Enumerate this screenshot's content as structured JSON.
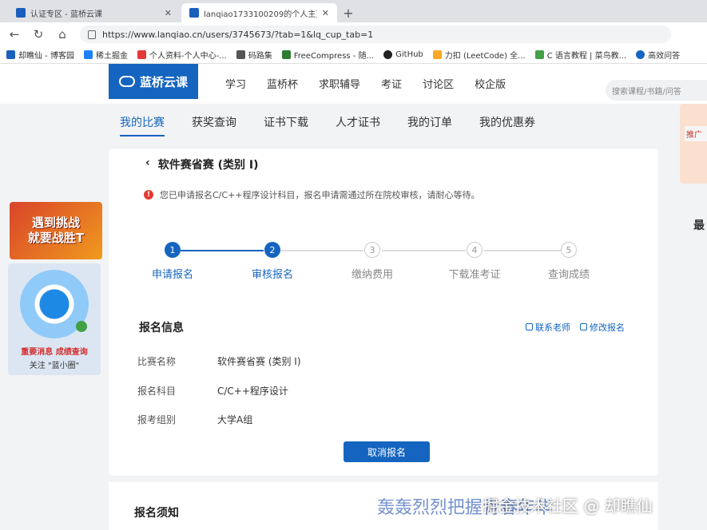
{
  "browser": {
    "tabs": [
      {
        "title": "认证专区 - 蓝桥云课",
        "active": false
      },
      {
        "title": "lanqiao1733100209的个人主页 -",
        "active": true
      }
    ],
    "new_tab": "+",
    "url": "https://www.lanqiao.cn/users/3745673/?tab=1&lq_cup_tab=1",
    "bookmarks": [
      "却瞧仙 - 博客园",
      "稀土掘金",
      "个人资料-个人中心-...",
      "码路集",
      "FreeCompress - 随...",
      "GitHub",
      "力扣 (LeetCode) 全...",
      "C 语言教程 | 菜鸟教...",
      "高效问答"
    ]
  },
  "site": {
    "logo": "蓝桥云课",
    "nav": [
      "学习",
      "蓝桥杯",
      "求职辅导",
      "考证",
      "讨论区",
      "校企版"
    ],
    "search_placeholder": "搜索课程/书籍/问答",
    "subnav": [
      "我的比赛",
      "获奖查询",
      "证书下载",
      "人才证书",
      "我的订单",
      "我的优惠券"
    ]
  },
  "ads": {
    "banner_line1": "遇到挑战",
    "banner_line2": "就要战胜T",
    "qr_line1": "重要消息 成绩查询",
    "qr_line2": "关注 \"蓝小圈\""
  },
  "right_edge": {
    "card_text": "推广",
    "mark": "最"
  },
  "contest": {
    "title": "软件赛省赛 (类别 I)",
    "notice": "您已申请报名C/C++程序设计科目，报名申请需通过所在院校审核，请耐心等待。",
    "steps": [
      {
        "num": "1",
        "label": "申请报名",
        "done": true
      },
      {
        "num": "2",
        "label": "审核报名",
        "done": true
      },
      {
        "num": "3",
        "label": "缴纳费用",
        "done": false
      },
      {
        "num": "4",
        "label": "下载准考证",
        "done": false
      },
      {
        "num": "5",
        "label": "查询成绩",
        "done": false
      }
    ],
    "info_title": "报名信息",
    "actions": {
      "contact": "联系老师",
      "edit": "修改报名"
    },
    "fields": [
      {
        "key": "比赛名称",
        "value": "软件赛省赛 (类别 I)"
      },
      {
        "key": "报名科目",
        "value": "C/C++程序设计"
      },
      {
        "key": "报考组别",
        "value": "大学A组"
      }
    ],
    "cancel_label": "取消报名",
    "notes_title": "报名须知"
  },
  "watermark": {
    "calligraphy": "轰轰烈烈把握青春年华",
    "credit": "掘金技术社区 @ 却瞧仙"
  },
  "colors": {
    "accent": "#1565c0",
    "alert": "#e53935"
  }
}
